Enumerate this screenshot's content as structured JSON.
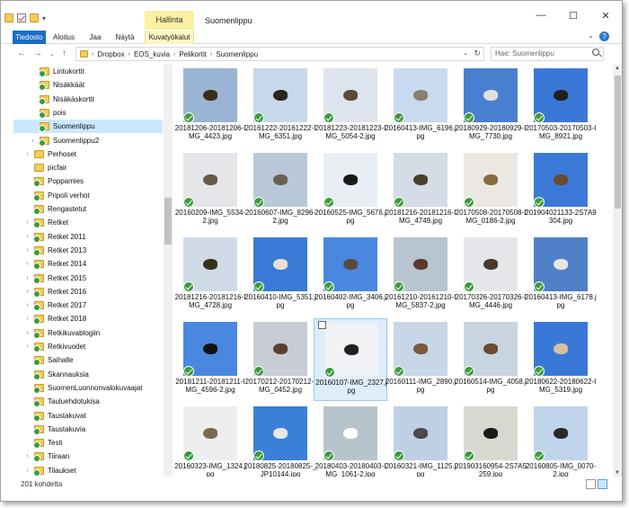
{
  "window": {
    "title": "Suomenlippu",
    "context_tab": "Hallinta",
    "controls": {
      "minimize": "—",
      "maximize": "☐",
      "close": "✕"
    }
  },
  "ribbon": {
    "tabs": [
      "Tiedosto",
      "Aloitus",
      "Jaa",
      "Näytä",
      "Kuvatyökalut"
    ],
    "expand": "⌄",
    "help": "?"
  },
  "nav": {
    "back": "←",
    "forward": "→",
    "recent": "⌄",
    "up": "↑"
  },
  "breadcrumb": [
    "Dropbox",
    "EOS_kuvia",
    "Pelikortit",
    "Suomenlippu"
  ],
  "search": {
    "placeholder": "Hae: Suomenlippu"
  },
  "sidebar": {
    "items": [
      {
        "label": "Lintukortit",
        "indent": 2,
        "arrow": "",
        "synced": true,
        "selected": false
      },
      {
        "label": "Nisäkkäät",
        "indent": 2,
        "arrow": "",
        "synced": true,
        "selected": false
      },
      {
        "label": "Nisäkäskortit",
        "indent": 2,
        "arrow": "",
        "synced": true,
        "selected": false
      },
      {
        "label": "pois",
        "indent": 2,
        "arrow": "",
        "synced": true,
        "selected": false
      },
      {
        "label": "Suomenlippu",
        "indent": 2,
        "arrow": "",
        "synced": true,
        "selected": true
      },
      {
        "label": "Suomenlippu2",
        "indent": 2,
        "arrow": "›",
        "synced": true,
        "selected": false
      },
      {
        "label": "Perhoset",
        "indent": 1,
        "arrow": "›",
        "synced": false,
        "selected": false
      },
      {
        "label": "picfair",
        "indent": 1,
        "arrow": "",
        "synced": false,
        "selected": false
      },
      {
        "label": "Poppamies",
        "indent": 1,
        "arrow": "",
        "synced": true,
        "selected": false
      },
      {
        "label": "Pripoli verhot",
        "indent": 1,
        "arrow": "",
        "synced": true,
        "selected": false
      },
      {
        "label": "Rengastetut",
        "indent": 1,
        "arrow": "",
        "synced": true,
        "selected": false
      },
      {
        "label": "Retket",
        "indent": 1,
        "arrow": "›",
        "synced": true,
        "selected": false
      },
      {
        "label": "Retket 2011",
        "indent": 1,
        "arrow": "›",
        "synced": true,
        "selected": false
      },
      {
        "label": "Retket 2013",
        "indent": 1,
        "arrow": "›",
        "synced": true,
        "selected": false
      },
      {
        "label": "Retket 2014",
        "indent": 1,
        "arrow": "›",
        "synced": true,
        "selected": false
      },
      {
        "label": "Retket 2015",
        "indent": 1,
        "arrow": "›",
        "synced": true,
        "selected": false
      },
      {
        "label": "Retket 2016",
        "indent": 1,
        "arrow": "›",
        "synced": true,
        "selected": false
      },
      {
        "label": "Retket 2017",
        "indent": 1,
        "arrow": "›",
        "synced": true,
        "selected": false
      },
      {
        "label": "Retket 2018",
        "indent": 1,
        "arrow": "›",
        "synced": true,
        "selected": false
      },
      {
        "label": "Retkikuvablogiin",
        "indent": 1,
        "arrow": "›",
        "synced": true,
        "selected": false
      },
      {
        "label": "Retkivuodet",
        "indent": 1,
        "arrow": "›",
        "synced": true,
        "selected": false
      },
      {
        "label": "Saihalle",
        "indent": 1,
        "arrow": "",
        "synced": true,
        "selected": false
      },
      {
        "label": "Skannauksia",
        "indent": 1,
        "arrow": "",
        "synced": true,
        "selected": false
      },
      {
        "label": "SuomenLuonnonvalokuvaajat",
        "indent": 1,
        "arrow": "",
        "synced": true,
        "selected": false
      },
      {
        "label": "Tauluehdotukisa",
        "indent": 1,
        "arrow": "",
        "synced": true,
        "selected": false
      },
      {
        "label": "Taustakuvat",
        "indent": 1,
        "arrow": "",
        "synced": true,
        "selected": false
      },
      {
        "label": "Taustakuvia",
        "indent": 1,
        "arrow": "",
        "synced": true,
        "selected": false
      },
      {
        "label": "Testi",
        "indent": 1,
        "arrow": "",
        "synced": true,
        "selected": false
      },
      {
        "label": "Tiiraan",
        "indent": 1,
        "arrow": "›",
        "synced": true,
        "selected": false
      },
      {
        "label": "Tilaukset",
        "indent": 1,
        "arrow": "›",
        "synced": true,
        "selected": false
      }
    ]
  },
  "files": [
    {
      "name": "20181206-2018120​6-IMG_4423.jpg",
      "bg": "#9ab4d4",
      "bird": "#3a2e1a",
      "selected": false
    },
    {
      "name": "20161222-2016122​2-IMG_6351.jpg",
      "bg": "#c8d8ec",
      "bird": "#2a2520",
      "selected": false
    },
    {
      "name": "20181223-2018122​3-IMG_5054-2.jpg",
      "bg": "#dde4ee",
      "bird": "#5a4a3a",
      "selected": false
    },
    {
      "name": "20160413-IMG_6196.jpg",
      "bg": "#c7daf0",
      "bird": "#8a8070",
      "selected": false
    },
    {
      "name": "20180929-2018092​9-IMG_7730.jpg",
      "bg": "#4a7fd0",
      "bird": "#e0e0e0",
      "selected": false
    },
    {
      "name": "20170503-2017050​3-IMG_8921.jpg",
      "bg": "#3a78d8",
      "bird": "#202020",
      "selected": false
    },
    {
      "name": "20160209-IMG_5534-2.jpg",
      "bg": "#e4e6ea",
      "bird": "#6a5a4a",
      "selected": false
    },
    {
      "name": "20160607-IMG_8296-2.jpg",
      "bg": "#b8c8d8",
      "bird": "#6a6050",
      "selected": false
    },
    {
      "name": "20160525-IMG_5676.jpg",
      "bg": "#e8eef4",
      "bird": "#1a1a1a",
      "selected": false
    },
    {
      "name": "20181216-2018121​6-IMG_4749.jpg",
      "bg": "#d4dce6",
      "bird": "#4a4030",
      "selected": false
    },
    {
      "name": "20170508-2017050​8-IMG_0186-2.jpg",
      "bg": "#ebe8e2",
      "bird": "#8a6a40",
      "selected": false
    },
    {
      "name": "20190402113​3-2S7A9304.jpg",
      "bg": "#3a7ad6",
      "bird": "#6a4a2a",
      "selected": false
    },
    {
      "name": "20181216-2018121​6-IMG_4728.jpg",
      "bg": "#d0dae6",
      "bird": "#3a3020",
      "selected": false
    },
    {
      "name": "20160410-IMG_5351.jpg",
      "bg": "#3a7ad6",
      "bird": "#e8e0d0",
      "selected": false
    },
    {
      "name": "20160402-IMG_3406.jpg",
      "bg": "#4a88e0",
      "bird": "#5a4a3a",
      "selected": false
    },
    {
      "name": "20161210-2016121​0-IMG_5837-2.jpg",
      "bg": "#b8c4d0",
      "bird": "#5a3a2a",
      "selected": false
    },
    {
      "name": "20170326-2017032​6-IMG_4446.jpg",
      "bg": "#e4e6ea",
      "bird": "#4a3a2a",
      "selected": false
    },
    {
      "name": "20160413-IMG_6178.jpg",
      "bg": "#5080c8",
      "bird": "#e8e8e0",
      "selected": false
    },
    {
      "name": "20181211-2018121​1-IMG_4596-2.jpg",
      "bg": "#4a88e0",
      "bird": "#111111",
      "selected": false
    },
    {
      "name": "20170212-2017021​2-IMG_0452.jpg",
      "bg": "#c8ccd4",
      "bird": "#5a4030",
      "selected": false
    },
    {
      "name": "20160107-IMG_2327.jpg",
      "bg": "#f0f2f6",
      "bird": "#202020",
      "selected": true
    },
    {
      "name": "20160111-IMG_2890.jpg",
      "bg": "#c8d6ea",
      "bird": "#7a5a3a",
      "selected": false
    },
    {
      "name": "20160514-IMG_4058.jpg",
      "bg": "#c8d4e0",
      "bird": "#6a4a30",
      "selected": false
    },
    {
      "name": "20180622-2018062​2-IMG_5319.jpg",
      "bg": "#3a78d8",
      "bird": "#d8c0a0",
      "selected": false
    },
    {
      "name": "20160323-IMG_1324.jpg",
      "bg": "#eeeeee",
      "bird": "#7a6a50",
      "selected": false
    },
    {
      "name": "20180825-2018082​5-_JP10144.jpg",
      "bg": "#3a80d8",
      "bird": "#e8e8e8",
      "selected": false
    },
    {
      "name": "20180403-2018040​3-IMG_1061-2.jpg",
      "bg": "#b8c4cc",
      "bird": "#ffffff",
      "selected": false
    },
    {
      "name": "20160321-IMG_1125.jpg",
      "bg": "#c0d0e4",
      "bird": "#4a4a4a",
      "selected": false
    },
    {
      "name": "20190316095​4-2S7A5259.jpg",
      "bg": "#d8d8d0",
      "bird": "#1a1a1a",
      "selected": false
    },
    {
      "name": "20160805-IMG_0070-2.jpg",
      "bg": "#c0d4ec",
      "bird": "#2a2a2a",
      "selected": false
    }
  ],
  "status": {
    "count": "201 kohdetta"
  },
  "colors": {
    "accent": "#1a6ec4",
    "selection": "#cce8ff",
    "sync_ok": "#3c9a3c",
    "context_tab": "#fbf0a2"
  },
  "icons": [
    "folder-icon",
    "checkbox-icon",
    "pin-icon",
    "back-arrow-icon",
    "forward-arrow-icon",
    "up-arrow-icon",
    "refresh-icon",
    "search-icon",
    "sync-ok-icon",
    "details-view-icon",
    "thumbnail-view-icon"
  ]
}
